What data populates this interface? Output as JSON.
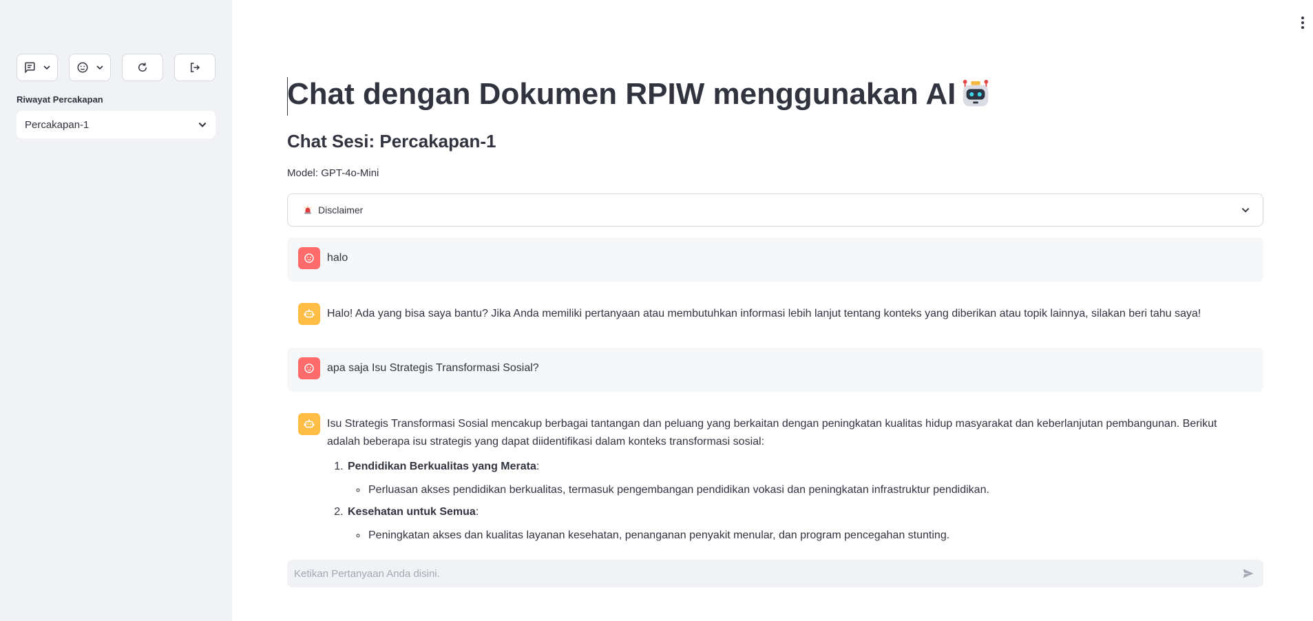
{
  "sidebar": {
    "history_label": "Riwayat Percakapan",
    "history_selected": "Percakapan-1"
  },
  "main": {
    "title": "Chat dengan Dokumen RPIW menggunakan AI",
    "subtitle": "Chat Sesi: Percakapan-1",
    "model": "Model: GPT-4o-Mini",
    "disclaimer_label": "Disclaimer"
  },
  "messages": [
    {
      "role": "user",
      "text": "halo"
    },
    {
      "role": "assistant",
      "text": "Halo! Ada yang bisa saya bantu? Jika Anda memiliki pertanyaan atau membutuhkan informasi lebih lanjut tentang konteks yang diberikan atau topik lainnya, silakan beri tahu saya!"
    },
    {
      "role": "user",
      "text": "apa saja Isu Strategis Transformasi Sosial?"
    },
    {
      "role": "assistant",
      "intro": "Isu Strategis Transformasi Sosial mencakup berbagai tantangan dan peluang yang berkaitan dengan peningkatan kualitas hidup masyarakat dan keberlanjutan pembangunan. Berikut adalah beberapa isu strategis yang dapat diidentifikasi dalam konteks transformasi sosial:",
      "items": [
        {
          "heading": "Pendidikan Berkualitas yang Merata",
          "suffix": ":",
          "bullets": [
            "Perluasan akses pendidikan berkualitas, termasuk pengembangan pendidikan vokasi dan peningkatan infrastruktur pendidikan."
          ]
        },
        {
          "heading": "Kesehatan untuk Semua",
          "suffix": ":",
          "bullets": [
            "Peningkatan akses dan kualitas layanan kesehatan, penanganan penyakit menular, dan program pencegahan stunting."
          ]
        }
      ]
    }
  ],
  "input": {
    "placeholder": "Ketikan Pertanyaan Anda disini."
  },
  "colors": {
    "sidebar_bg": "#f0f2f6",
    "user_avatar": "#ff6b6b",
    "assistant_avatar": "#ffbd45",
    "user_msg_bg": "#f6f7f9"
  },
  "icons": {
    "sidebar_buttons": [
      "chat-icon",
      "face-icon",
      "refresh-icon",
      "logout-icon"
    ],
    "user_avatar": "face-icon",
    "assistant_avatar": "robot-icon",
    "disclaimer": "siren-icon",
    "send": "send-icon"
  }
}
